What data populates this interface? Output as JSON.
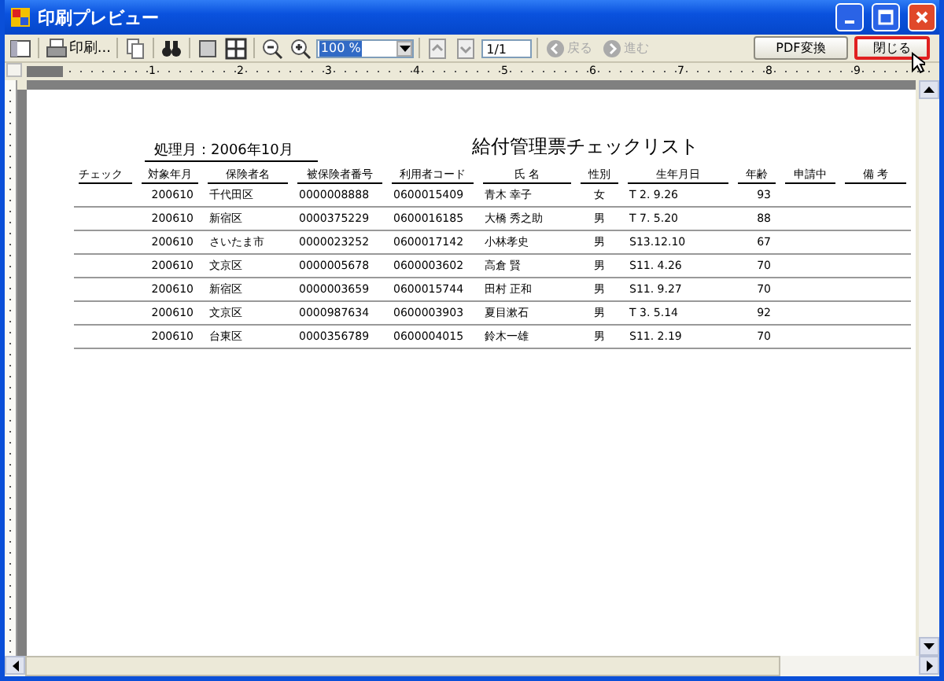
{
  "window": {
    "title": "印刷プレビュー"
  },
  "toolbar": {
    "print_label": "印刷...",
    "zoom": "100 %",
    "page": "1/1",
    "nav": [
      {
        "label": "戻る",
        "disabled": true
      },
      {
        "label": "進む",
        "disabled": true
      }
    ],
    "buttons": [
      {
        "label": "PDF変換",
        "highlighted": false
      },
      {
        "label": "閉じる",
        "highlighted": true
      }
    ]
  },
  "ruler": {
    "labels": [
      "1",
      "2",
      "3",
      "4",
      "5",
      "6",
      "7",
      "8",
      "9"
    ]
  },
  "report": {
    "period": "処理月：2006年10月",
    "title": "給付管理票チェックリスト",
    "columns": [
      "チェック",
      "対象年月",
      "保険者名",
      "被保険者番号",
      "利用者コード",
      "氏 名",
      "性別",
      "生年月日",
      "年齢",
      "申請中",
      "備 考"
    ],
    "rows": [
      [
        "",
        "200610",
        "千代田区",
        "0000008888",
        "0600015409",
        "青木  幸子",
        "女",
        "T 2. 9.26",
        "93",
        "",
        ""
      ],
      [
        "",
        "200610",
        "新宿区",
        "0000375229",
        "0600016185",
        "大橋  秀之助",
        "男",
        "T 7. 5.20",
        "88",
        "",
        ""
      ],
      [
        "",
        "200610",
        "さいたま市",
        "0000023252",
        "0600017142",
        "小林孝史",
        "男",
        "S13.12.10",
        "67",
        "",
        ""
      ],
      [
        "",
        "200610",
        "文京区",
        "0000005678",
        "0600003602",
        "高倉  賢",
        "男",
        "S11. 4.26",
        "70",
        "",
        ""
      ],
      [
        "",
        "200610",
        "新宿区",
        "0000003659",
        "0600015744",
        "田村  正和",
        "男",
        "S11. 9.27",
        "70",
        "",
        ""
      ],
      [
        "",
        "200610",
        "文京区",
        "0000987634",
        "0600003903",
        "夏目漱石",
        "男",
        "T 3. 5.14",
        "92",
        "",
        ""
      ],
      [
        "",
        "200610",
        "台東区",
        "0000356789",
        "0600004015",
        "鈴木一雄",
        "男",
        "S11. 2.19",
        "70",
        "",
        ""
      ]
    ]
  }
}
